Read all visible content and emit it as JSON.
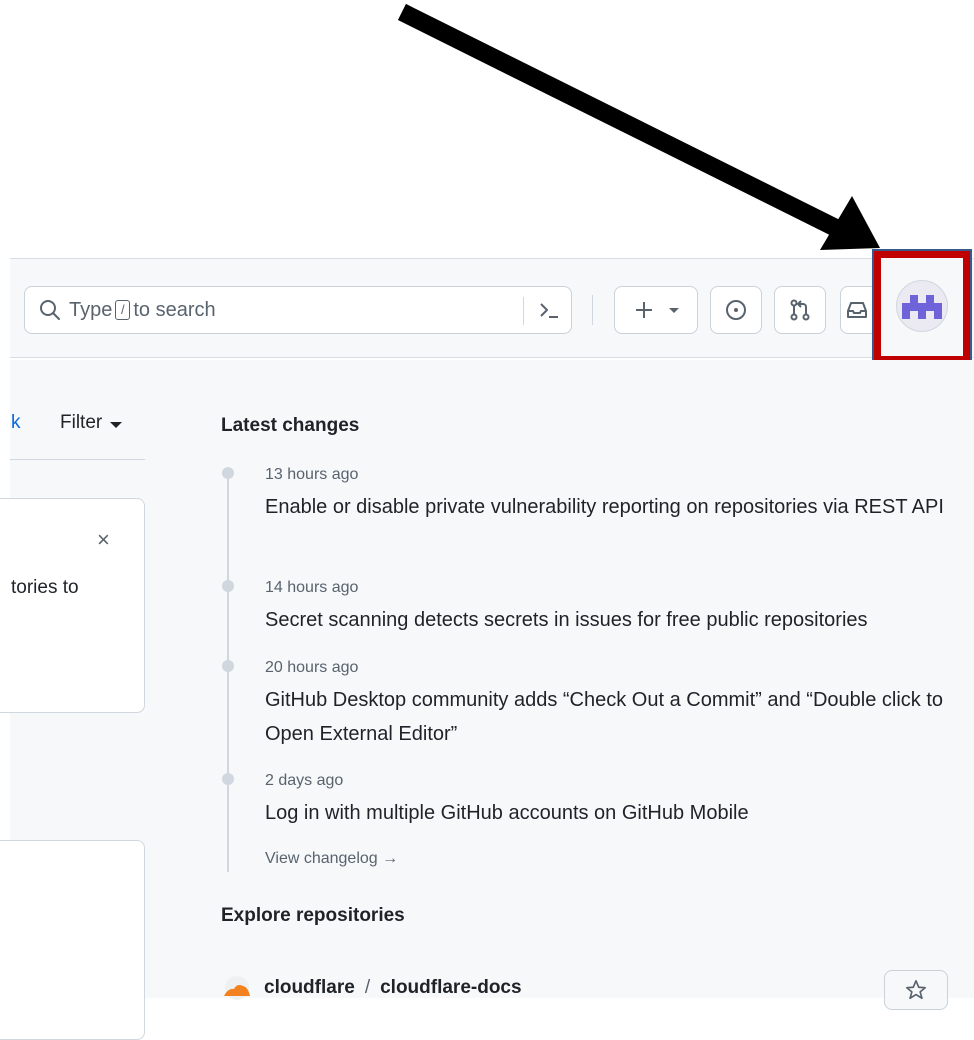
{
  "header": {
    "search_placeholder_prefix": "Type",
    "search_key": "/",
    "search_placeholder_suffix": "to search"
  },
  "feed": {
    "link_fragment": "k",
    "filter_label": "Filter",
    "card_close": "×",
    "card_text_fragment": "tories to"
  },
  "latest_changes": {
    "title": "Latest changes",
    "items": [
      {
        "time": "13 hours ago",
        "text": "Enable or disable private vulnerability reporting on repositories via REST API"
      },
      {
        "time": "14 hours ago",
        "text": "Secret scanning detects secrets in issues for free public repositories"
      },
      {
        "time": "20 hours ago",
        "text": "GitHub Desktop community adds “Check Out a Commit” and “Double click to Open External Editor”"
      },
      {
        "time": "2 days ago",
        "text": "Log in with multiple GitHub accounts on GitHub Mobile"
      }
    ],
    "view_changelog": "View changelog →"
  },
  "explore": {
    "title": "Explore repositories",
    "repo_owner": "cloudflare",
    "repo_separator": "/",
    "repo_name": "cloudflare-docs"
  },
  "colors": {
    "highlight_box": "#c00000",
    "annotation_arrow": "#000000",
    "avatar_purple": "#6f63d9",
    "link_blue": "#0969da"
  }
}
